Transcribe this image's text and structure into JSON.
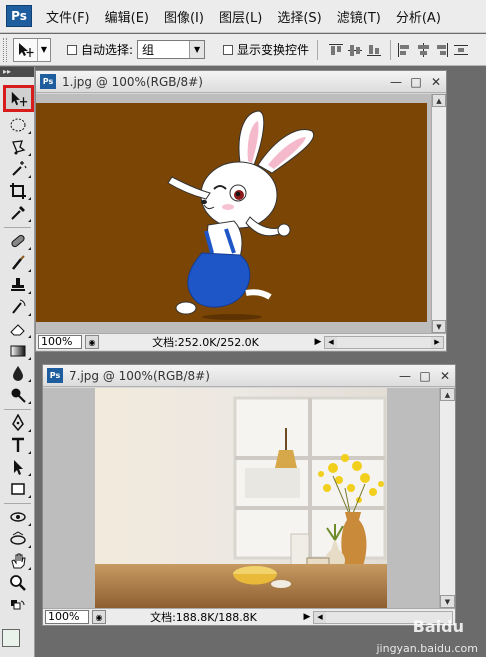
{
  "menubar": {
    "logo": "Ps",
    "items": [
      "文件(F)",
      "编辑(E)",
      "图像(I)",
      "图层(L)",
      "选择(S)",
      "滤镜(T)",
      "分析(A)"
    ]
  },
  "options": {
    "auto_select_label": "自动选择:",
    "auto_select_value": "组",
    "show_transform_label": "显示变换控件"
  },
  "doc1": {
    "title": "1.jpg @ 100%(RGB/8#)",
    "zoom": "100%",
    "info": "文档:252.0K/252.0K",
    "bg_color": "#7b4505"
  },
  "doc2": {
    "title": "7.jpg @ 100%(RGB/8#)",
    "zoom": "100%",
    "info": "文档:188.8K/188.8K"
  },
  "window_buttons": {
    "minimize": "—",
    "maximize": "□",
    "close": "✕"
  },
  "watermark": {
    "line1": "Baidu",
    "line2": "jingyan.baidu.com"
  },
  "colors": {
    "selected_tool_outline": "#d81c1c",
    "ps_blue": "#1e5d9e"
  }
}
